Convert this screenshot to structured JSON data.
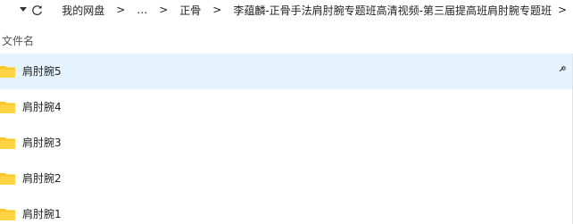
{
  "breadcrumb": {
    "items": [
      {
        "label": "我的网盘"
      },
      {
        "label": "…"
      },
      {
        "label": "正骨"
      },
      {
        "label": "李蕴麟-正骨手法肩肘腕专题班高清视频-第三届提高班肩肘腕专题班"
      }
    ],
    "separator": ">"
  },
  "list": {
    "column_header": "文件名",
    "rows": [
      {
        "name": "肩肘腕5",
        "selected": true
      },
      {
        "name": "肩肘腕4",
        "selected": false
      },
      {
        "name": "肩肘腕3",
        "selected": false
      },
      {
        "name": "肩肘腕2",
        "selected": false
      },
      {
        "name": "肩肘腕1",
        "selected": false
      }
    ]
  },
  "icons": {
    "dropdown": "chevron-down-icon",
    "refresh": "refresh-icon",
    "folder": "folder-icon",
    "folder_color": "#f9c828",
    "selection_color": "#e5f3ff"
  }
}
